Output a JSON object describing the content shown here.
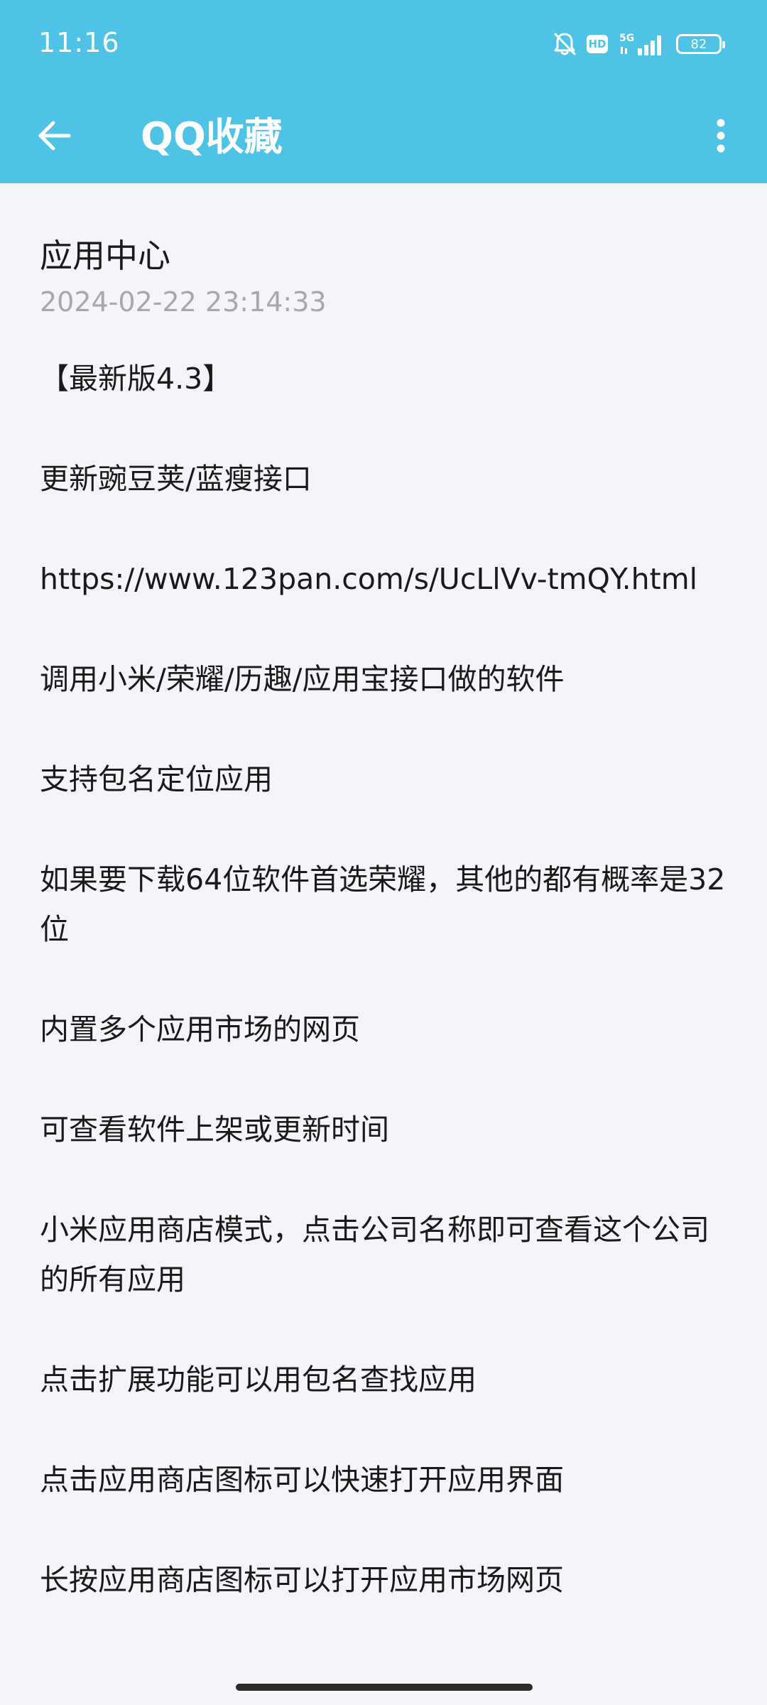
{
  "status_bar": {
    "time": "11:16",
    "network": "5G",
    "battery": "82",
    "icons": [
      "bell-muted-icon",
      "hd-icon",
      "5g-signal-icon",
      "battery-icon"
    ]
  },
  "app_bar": {
    "title": "QQ收藏",
    "back_icon": "arrow-left-icon",
    "more_icon": "more-vertical-icon",
    "color": "#4fc3e6"
  },
  "note": {
    "title": "应用中心",
    "timestamp": "2024-02-22 23:14:33",
    "lines": [
      "【最新版4.3】",
      "更新豌豆荚/蓝瘦接口",
      "https://www.123pan.com/s/UcLlVv-tmQY.html",
      "调用小米/荣耀/历趣/应用宝接口做的软件",
      "支持包名定位应用",
      "如果要下载64位软件首选荣耀，其他的都有概率是32位",
      "内置多个应用市场的网页",
      "可查看软件上架或更新时间",
      "小米应用商店模式，点击公司名称即可查看这个公司的所有应用",
      "点击扩展功能可以用包名查找应用",
      "点击应用商店图标可以快速打开应用界面",
      "长按应用商店图标可以打开应用市场网页"
    ]
  }
}
